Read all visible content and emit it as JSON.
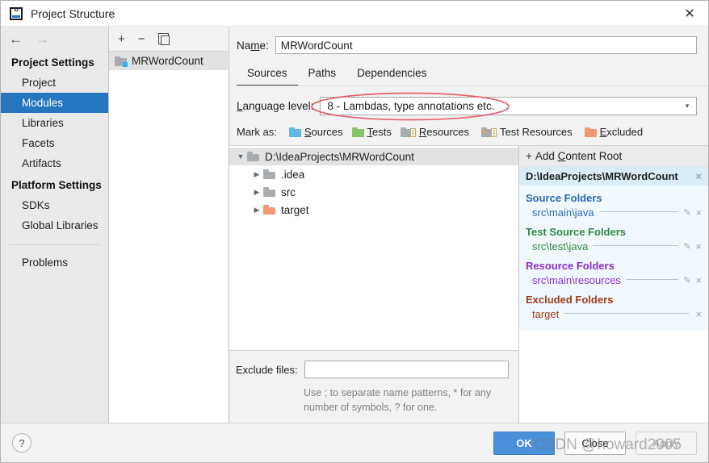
{
  "window": {
    "title": "Project Structure",
    "close_label": "✕",
    "app_icon": "intellij-idea-icon"
  },
  "sidebar": {
    "back_arrow": "←",
    "forward_arrow": "→",
    "groups": [
      {
        "title": "Project Settings",
        "items": [
          {
            "label": "Project",
            "selected": false
          },
          {
            "label": "Modules",
            "selected": true
          },
          {
            "label": "Libraries",
            "selected": false
          },
          {
            "label": "Facets",
            "selected": false
          },
          {
            "label": "Artifacts",
            "selected": false
          }
        ]
      },
      {
        "title": "Platform Settings",
        "items": [
          {
            "label": "SDKs",
            "selected": false
          },
          {
            "label": "Global Libraries",
            "selected": false
          }
        ]
      }
    ],
    "problems_label": "Problems"
  },
  "modules_panel": {
    "toolbar": {
      "add": "+",
      "remove": "−",
      "copy": "copy-icon"
    },
    "items": [
      {
        "label": "MRWordCount",
        "selected": true
      }
    ]
  },
  "module_detail": {
    "name_label_pre": "Na",
    "name_label_accel": "m",
    "name_label_post": "e:",
    "name_value": "MRWordCount",
    "tabs": [
      {
        "label": "Sources",
        "active": true
      },
      {
        "label": "Paths",
        "active": false
      },
      {
        "label": "Dependencies",
        "active": false
      }
    ],
    "language_level": {
      "label_accel": "L",
      "label_rest": "anguage level:",
      "value": "8 - Lambdas, type annotations etc.",
      "caret": "▾"
    },
    "mark_as": {
      "label": "Mark as:",
      "options": [
        {
          "accel": "S",
          "rest": "ources",
          "color": "#62b8e0",
          "icon": "folder-sources-icon"
        },
        {
          "accel": "T",
          "rest": "ests",
          "color": "#86c46a",
          "icon": "folder-tests-icon"
        },
        {
          "accel": "R",
          "rest": "esources",
          "color": "#a7acb0",
          "icon": "folder-resources-icon"
        },
        {
          "accel": "",
          "rest": "Test Resources",
          "color": "#a7acb0",
          "icon": "folder-test-resources-icon"
        },
        {
          "accel": "E",
          "rest": "xcluded",
          "color": "#ef9a74",
          "icon": "folder-excluded-icon"
        }
      ]
    }
  },
  "tree": {
    "rows": [
      {
        "label": "D:\\IdeaProjects\\MRWordCount",
        "depth": 0,
        "twisty": "▼",
        "folder": "gray",
        "selected": true
      },
      {
        "label": ".idea",
        "depth": 1,
        "twisty": "▶",
        "folder": "gray",
        "selected": false
      },
      {
        "label": "src",
        "depth": 1,
        "twisty": "▶",
        "folder": "gray",
        "selected": false
      },
      {
        "label": "target",
        "depth": 1,
        "twisty": "▶",
        "folder": "orange",
        "selected": false
      }
    ]
  },
  "exclude": {
    "label": "Exclude files:",
    "value": "",
    "placeholder": "",
    "hint": "Use ; to separate name patterns, * for any number of symbols, ? for one."
  },
  "content_roots": {
    "add_label_pre": "Add ",
    "add_label_accel": "C",
    "add_label_post": "ontent Root",
    "add_plus": "+",
    "root_path": "D:\\IdeaProjects\\MRWordCount",
    "close_glyph": "×",
    "pencil_glyph": "✎",
    "groups": [
      {
        "title": "Source Folders",
        "kind": "src",
        "entries": [
          {
            "path": "src\\main\\java",
            "editable": true
          }
        ]
      },
      {
        "title": "Test Source Folders",
        "kind": "test",
        "entries": [
          {
            "path": "src\\test\\java",
            "editable": true
          }
        ]
      },
      {
        "title": "Resource Folders",
        "kind": "res",
        "entries": [
          {
            "path": "src\\main\\resources",
            "editable": true
          }
        ]
      },
      {
        "title": "Excluded Folders",
        "kind": "exc",
        "entries": [
          {
            "path": "target",
            "editable": false
          }
        ]
      }
    ]
  },
  "footer": {
    "help_glyph": "?",
    "ok_label": "OK",
    "close_label": "Close",
    "apply_label": "Apply"
  },
  "annotation": {
    "shape": "red-ellipse-highlight",
    "color": "#e8606a"
  },
  "watermark": {
    "text": "CSDN @howard2005"
  }
}
